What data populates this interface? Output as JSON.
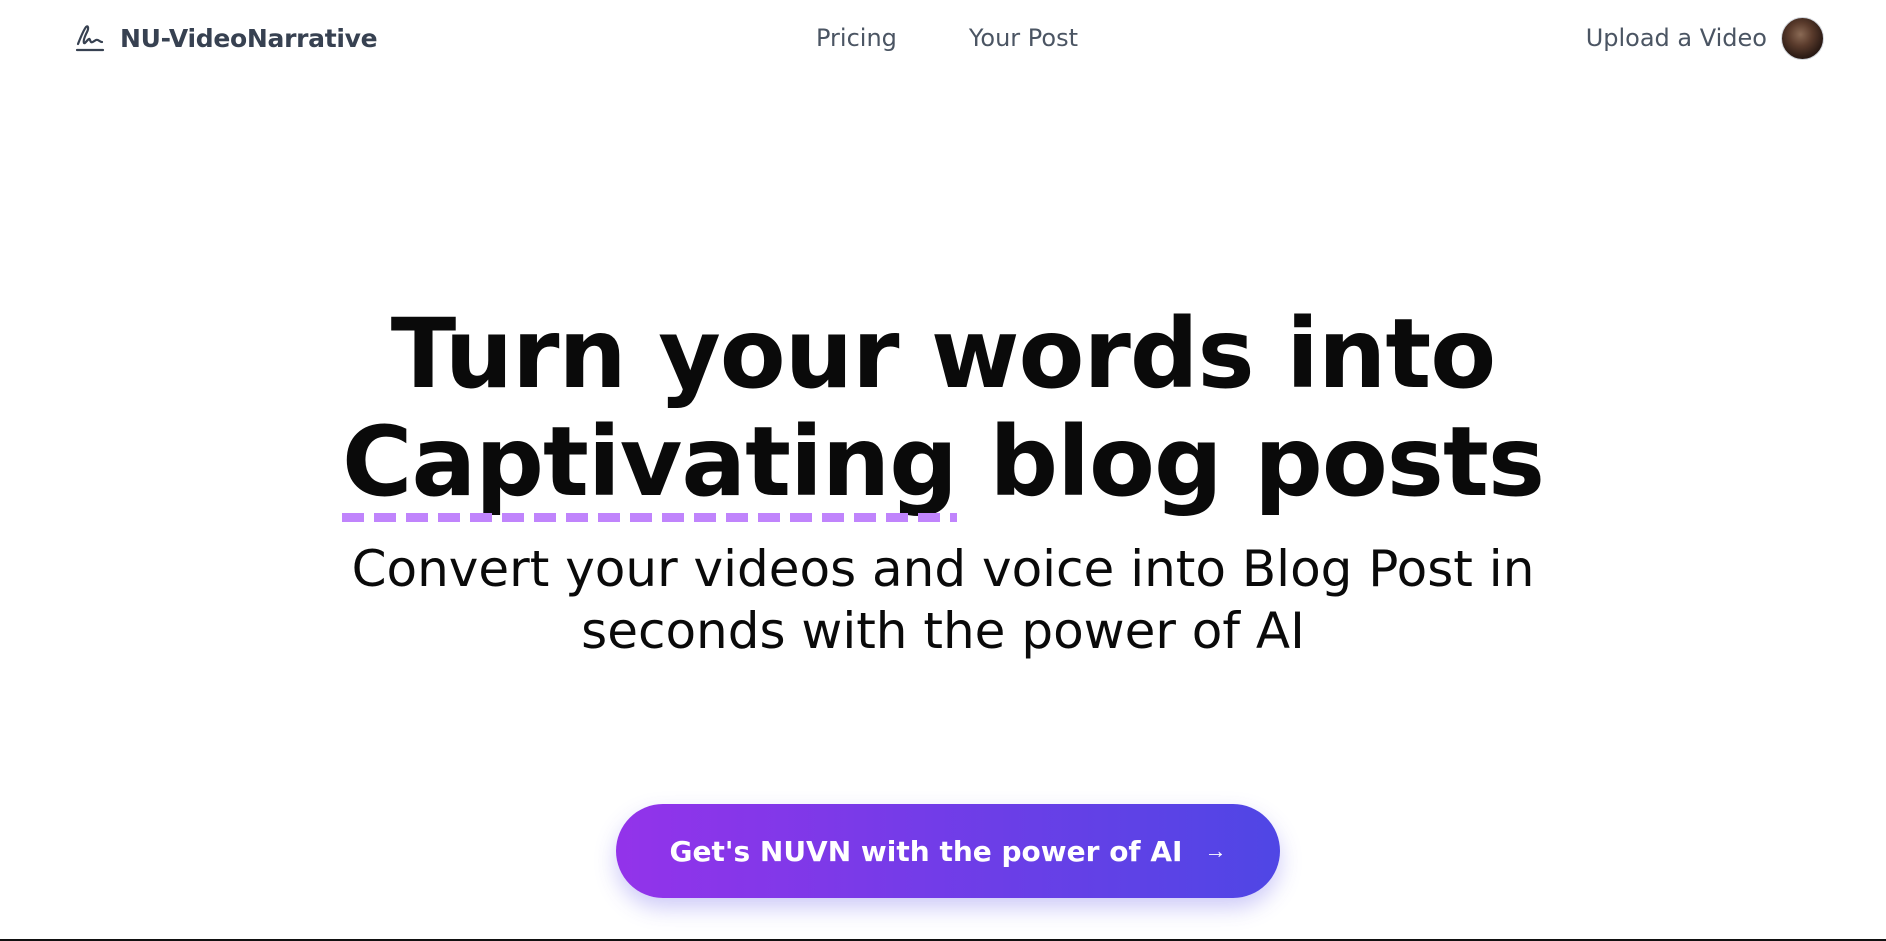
{
  "header": {
    "brand": {
      "name": "NU-VideoNarrative",
      "icon": "signature-icon"
    },
    "nav": [
      {
        "label": "Pricing"
      },
      {
        "label": "Your Post"
      }
    ],
    "upload_link": "Upload a Video",
    "avatar_icon": "user-avatar"
  },
  "hero": {
    "headline_line1": "Turn your words into",
    "headline_highlight": "Captivating",
    "headline_rest": " blog posts",
    "subhead": "Convert your videos and voice into Blog Post in seconds with the power of AI",
    "cta_label": "Get's NUVN with the power of AI",
    "cta_arrow": "→"
  },
  "colors": {
    "brand_text": "#374151",
    "nav_text": "#4b5563",
    "headline": "#0a0a0a",
    "highlight_underline": "#c084fc",
    "cta_gradient_start": "#9333ea",
    "cta_gradient_end": "#4f46e5",
    "cta_text": "#ffffff"
  }
}
